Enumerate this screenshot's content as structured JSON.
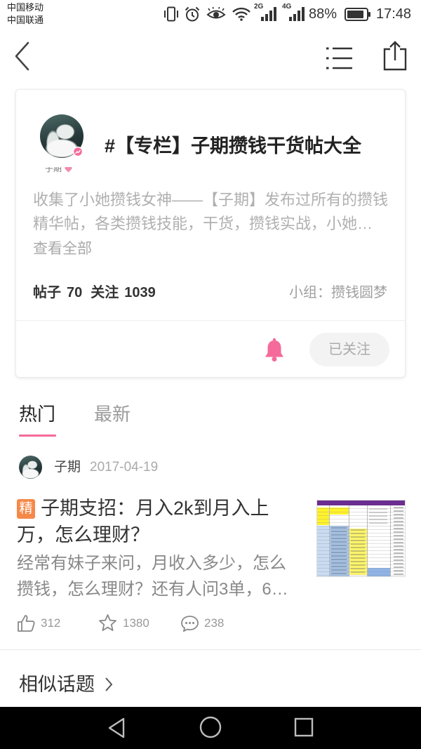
{
  "status_bar": {
    "carriers": [
      "中国移动",
      "中国联通"
    ],
    "network_2g": "2G",
    "network_4g": "4G",
    "battery": "88%",
    "time": "17:48",
    "icons": [
      "vibrate-icon",
      "alarm-icon",
      "eye-icon",
      "wifi-icon",
      "signal-icon",
      "battery-icon"
    ]
  },
  "header": {
    "icons": {
      "back": "chevron-left-icon",
      "menu": "list-icon",
      "share": "share-icon"
    }
  },
  "topic": {
    "avatar_name": "子期",
    "title": "#【专栏】子期攒钱干货帖大全",
    "description_lines": [
      "收集了小她攒钱女神——【子期】发布过所有的攒钱",
      "精华帖，各类攒钱技能，干货，攒钱实战，小她…"
    ],
    "view_all": "查看全部",
    "stats": {
      "posts_label": "帖子",
      "posts": "70",
      "follows_label": "关注",
      "follows": "1039"
    },
    "group": "小组：攒钱圆梦",
    "follow_button": "已关注"
  },
  "tabs": [
    {
      "label": "热门",
      "active": true
    },
    {
      "label": "最新",
      "active": false
    }
  ],
  "posts": [
    {
      "author": "子期",
      "date": "2017-04-19",
      "badge": "精",
      "title_lines": [
        "子期支招：月入2k到月入上",
        "万，怎么理财？"
      ],
      "snippet_lines": [
        "经常有妹子来问，月收入多少，怎么",
        "攒钱，怎么理财？还有人问3单，6…"
      ],
      "likes": "312",
      "favorites": "1380",
      "comments": "238"
    }
  ],
  "similar_topics": "相似话题",
  "colors": {
    "accent": "#f46a9b",
    "badge": "#f5894a",
    "nav_bar": "#000000",
    "button_bg": "#f3f3f3"
  }
}
